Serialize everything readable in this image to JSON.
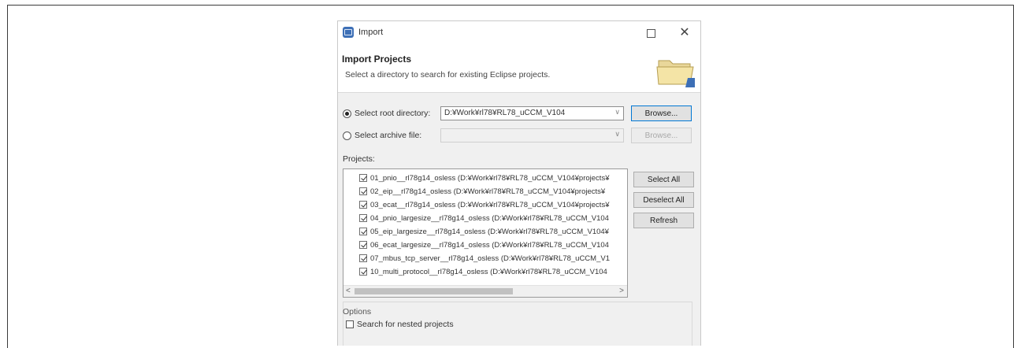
{
  "dialog": {
    "title": "Import",
    "heading": "Import Projects",
    "description": "Select a directory to search for existing Eclipse projects."
  },
  "source": {
    "root_label": "Select root directory:",
    "root_value": "D:¥Work¥rl78¥RL78_uCCM_V104",
    "archive_label": "Select archive file:",
    "archive_value": "",
    "browse_label": "Browse...",
    "browse_disabled_label": "Browse..."
  },
  "projects": {
    "label": "Projects:",
    "items": [
      "01_pnio__rl78g14_osless (D:¥Work¥rl78¥RL78_uCCM_V104¥projects¥",
      "02_eip__rl78g14_osless (D:¥Work¥rl78¥RL78_uCCM_V104¥projects¥",
      "03_ecat__rl78g14_osless (D:¥Work¥rl78¥RL78_uCCM_V104¥projects¥",
      "04_pnio_largesize__rl78g14_osless (D:¥Work¥rl78¥RL78_uCCM_V104",
      "05_eip_largesize__rl78g14_osless (D:¥Work¥rl78¥RL78_uCCM_V104¥",
      "06_ecat_largesize__rl78g14_osless (D:¥Work¥rl78¥RL78_uCCM_V104",
      "07_mbus_tcp_server__rl78g14_osless (D:¥Work¥rl78¥RL78_uCCM_V1",
      "10_multi_protocol__rl78g14_osless (D:¥Work¥rl78¥RL78_uCCM_V104"
    ],
    "select_all": "Select All",
    "deselect_all": "Deselect All",
    "refresh": "Refresh",
    "scroll_left": "<",
    "scroll_right": ">"
  },
  "options": {
    "title": "Options",
    "search_nested": "Search for nested projects"
  },
  "window_controls": {
    "close": "✕"
  },
  "icons": {
    "app": "eclipse-icon",
    "banner": "folder-icon"
  }
}
